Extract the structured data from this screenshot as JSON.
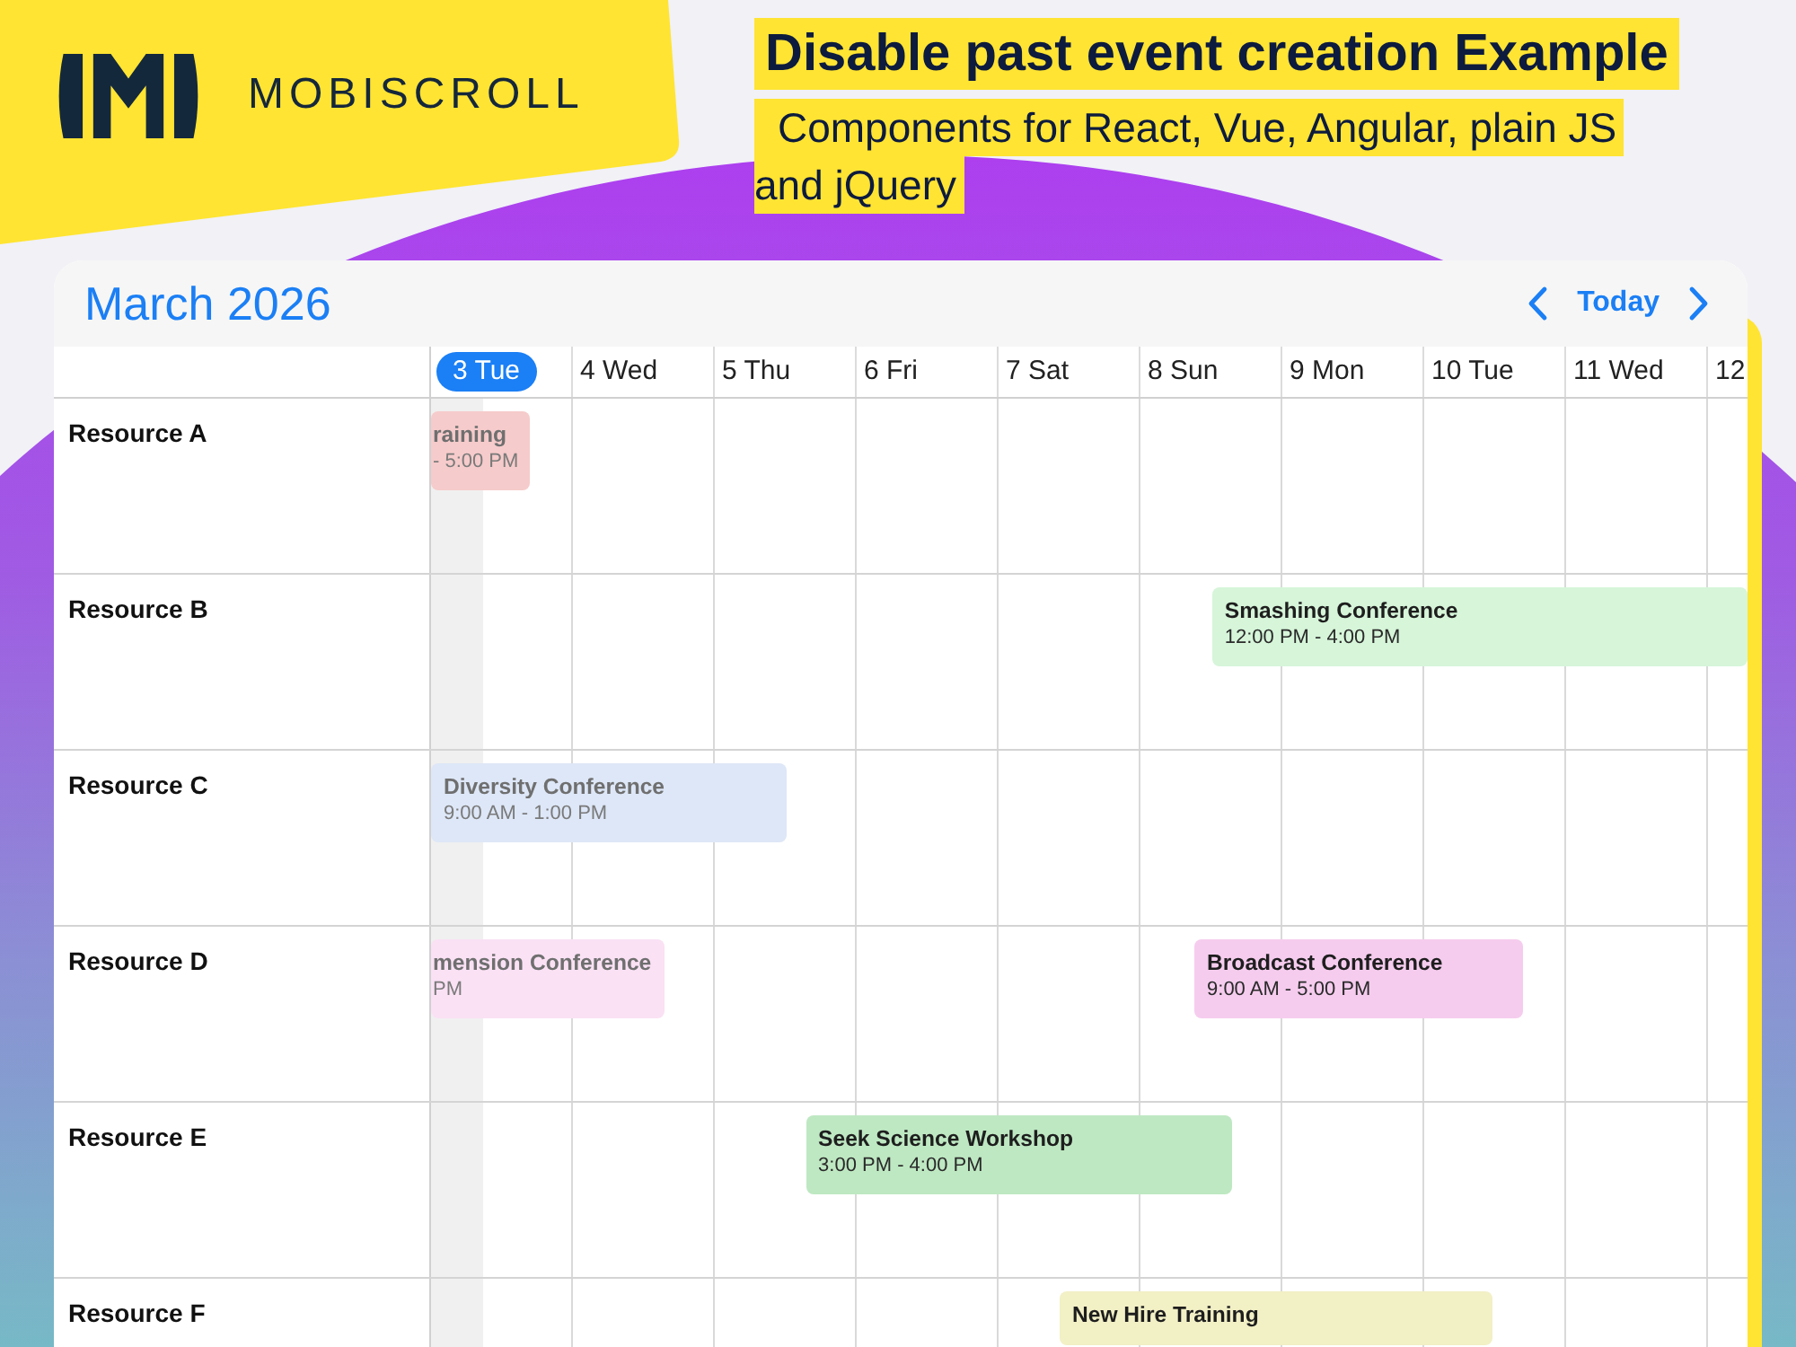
{
  "brand": {
    "name": "MOBISCROLL"
  },
  "header": {
    "title": "Disable past event creation Example",
    "subtitle_lines": [
      "Components for React, Vue, Angular, plain JS",
      "and jQuery"
    ]
  },
  "calendar": {
    "title": "March 2026",
    "today_button": "Today",
    "days": [
      {
        "label": "3 Tue",
        "selected": true
      },
      {
        "label": "4 Wed",
        "selected": false
      },
      {
        "label": "5 Thu",
        "selected": false
      },
      {
        "label": "6 Fri",
        "selected": false
      },
      {
        "label": "7 Sat",
        "selected": false
      },
      {
        "label": "8 Sun",
        "selected": false
      },
      {
        "label": "9 Mon",
        "selected": false
      },
      {
        "label": "10 Tue",
        "selected": false
      },
      {
        "label": "11 Wed",
        "selected": false
      },
      {
        "label": "12",
        "selected": false
      }
    ],
    "resources": [
      {
        "name": "Resource A",
        "events": [
          {
            "title": "raining",
            "time": "- 5:00 PM",
            "color": "#f6cbcb",
            "past": true
          }
        ]
      },
      {
        "name": "Resource B",
        "events": [
          {
            "title": "Smashing Conference",
            "time": "12:00 PM - 4:00 PM",
            "color": "#d6f5d9",
            "past": false
          }
        ]
      },
      {
        "name": "Resource C",
        "events": [
          {
            "title": "Diversity Conference",
            "time": "9:00 AM - 1:00 PM",
            "color": "#dde7f7",
            "past": true
          }
        ]
      },
      {
        "name": "Resource D",
        "events": [
          {
            "title": "mension Conference",
            "time": "PM",
            "color": "#fae1f4",
            "past": true
          },
          {
            "title": "Broadcast Conference",
            "time": "9:00 AM - 5:00 PM",
            "color": "#f5ccee",
            "past": false
          }
        ]
      },
      {
        "name": "Resource E",
        "events": [
          {
            "title": "Seek Science Workshop",
            "time": "3:00 PM - 4:00 PM",
            "color": "#bee8c2",
            "past": false
          }
        ]
      },
      {
        "name": "Resource F",
        "events": [
          {
            "title": "New Hire Training",
            "color": "#f2f0c5",
            "past": false
          }
        ]
      }
    ]
  }
}
